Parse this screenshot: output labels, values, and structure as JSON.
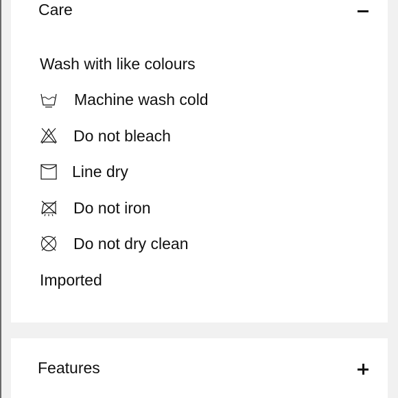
{
  "care": {
    "title": "Care",
    "toggle": "minus",
    "intro": "Wash with like colours",
    "items": [
      {
        "icon": "machine-wash-cold-icon",
        "label": "Machine wash cold"
      },
      {
        "icon": "do-not-bleach-icon",
        "label": "Do not bleach"
      },
      {
        "icon": "line-dry-icon",
        "label": "Line dry"
      },
      {
        "icon": "do-not-iron-icon",
        "label": "Do not iron"
      },
      {
        "icon": "do-not-dry-clean-icon",
        "label": "Do not dry clean"
      }
    ],
    "origin": "Imported"
  },
  "features": {
    "title": "Features",
    "toggle": "plus"
  }
}
